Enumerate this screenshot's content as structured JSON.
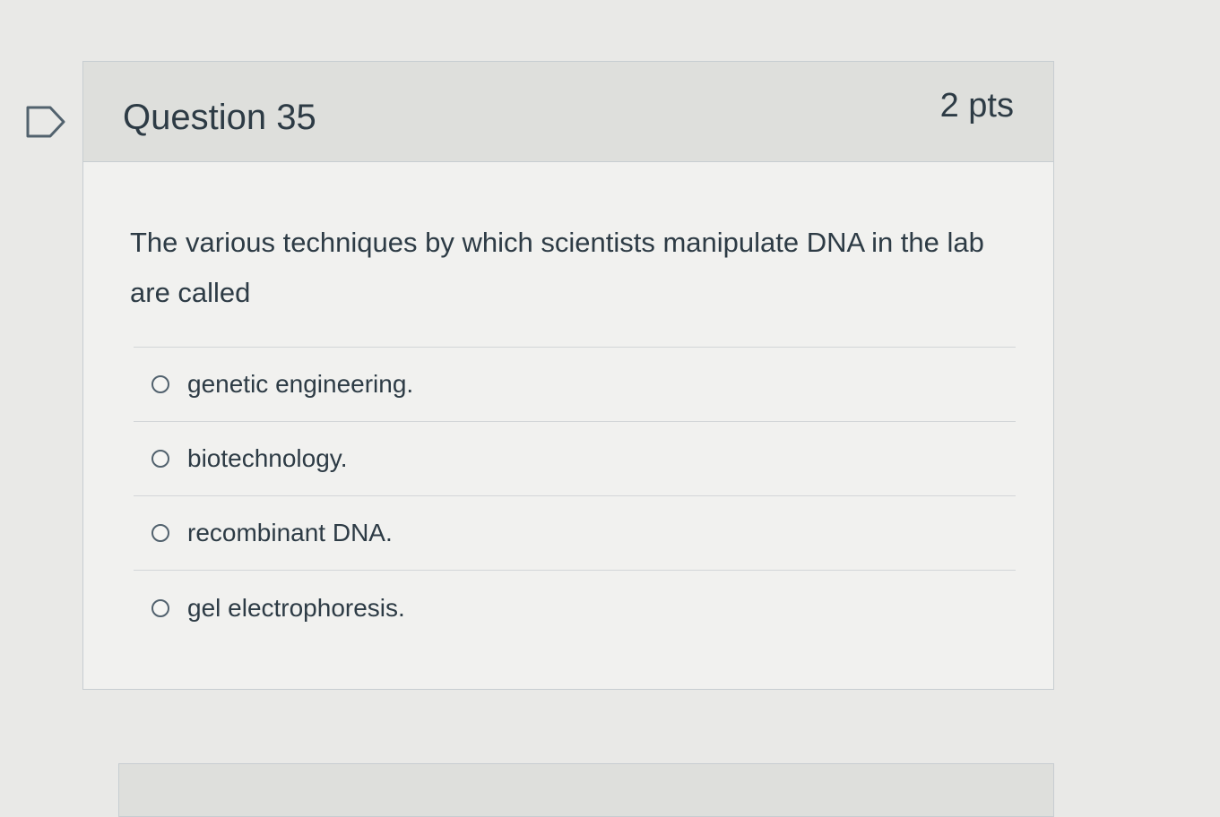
{
  "question": {
    "title": "Question 35",
    "points": "2 pts",
    "text": "The various techniques by which scientists manipulate DNA in the lab are called",
    "flag_icon": "flag-outline-icon"
  },
  "answers": [
    {
      "label": "genetic engineering.",
      "selected": false
    },
    {
      "label": "biotechnology.",
      "selected": false
    },
    {
      "label": "recombinant DNA.",
      "selected": false
    },
    {
      "label": "gel electrophoresis.",
      "selected": false
    }
  ],
  "colors": {
    "text": "#2d3b45",
    "header_bg": "#dedfdc",
    "card_bg": "#f1f1ef",
    "border": "#c7cdd1"
  }
}
